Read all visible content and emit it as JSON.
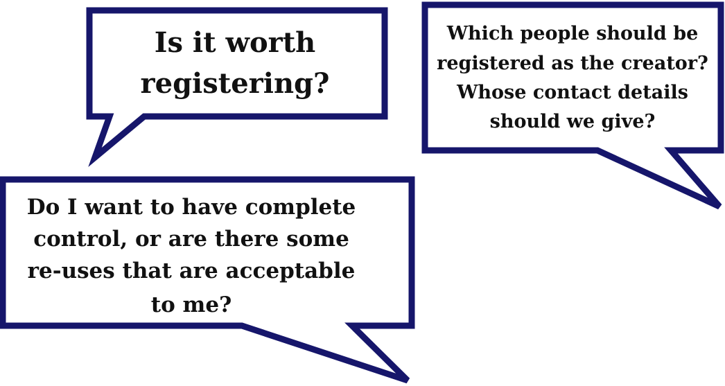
{
  "bubbles": [
    {
      "id": "worth-registering",
      "lines": [
        "Is it worth",
        "registering?"
      ]
    },
    {
      "id": "creator-contact",
      "lines": [
        "Which people should be",
        "registered as the creator?",
        "Whose contact details",
        "should we give?"
      ]
    },
    {
      "id": "control-reuse",
      "lines": [
        "Do I want to have complete",
        "control, or are there some",
        "re-uses that are acceptable",
        "to me?"
      ]
    }
  ],
  "colors": {
    "bubble_border": "#16166b",
    "bubble_fill": "#ffffff",
    "text": "#111111"
  }
}
